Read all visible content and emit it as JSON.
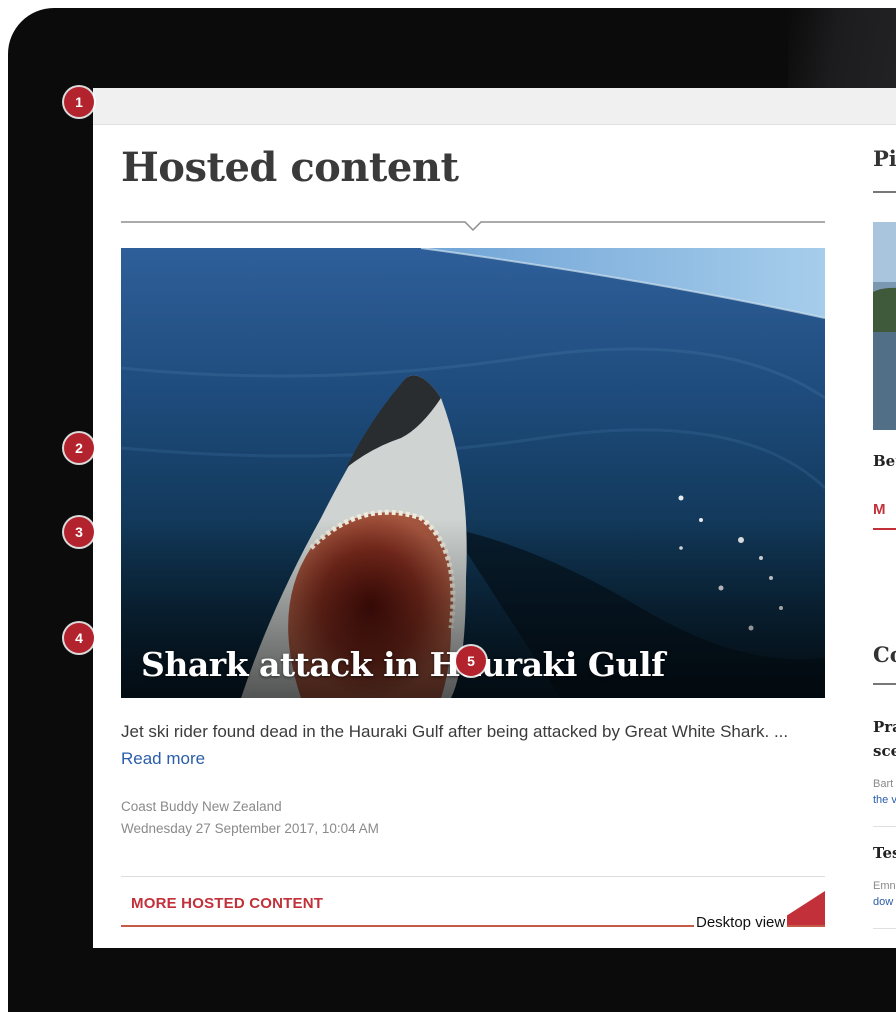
{
  "main": {
    "title": "Hosted content",
    "hero_title": "Shark attack in Hauraki Gulf",
    "summary": "Jet ski rider found dead in the Hauraki Gulf after being attacked by Great White Shark. ...",
    "read_more": "Read more",
    "source": "Coast Buddy New Zealand",
    "date": "Wednesday 27 September 2017, 10:04 AM",
    "more_link": "MORE HOSTED CONTENT",
    "plus": "+"
  },
  "sidebar": {
    "heading_1": "Pi",
    "item_title": "Bet",
    "more_1": "M",
    "heading_2": "Co",
    "article_1_line1": "Pra",
    "article_1_line2": "sce",
    "article_1_author": "Bart",
    "article_1_link": "the v",
    "article_2_title": "Tes",
    "article_2_author": "Emn",
    "article_2_link": "dow"
  },
  "caption": "Desktop view",
  "badges": [
    "1",
    "2",
    "3",
    "4",
    "5"
  ],
  "colors": {
    "accent_red": "#c2303a",
    "badge_red": "#b3232e",
    "link_blue": "#2b5ea8",
    "frame": "#0b0b0b"
  }
}
